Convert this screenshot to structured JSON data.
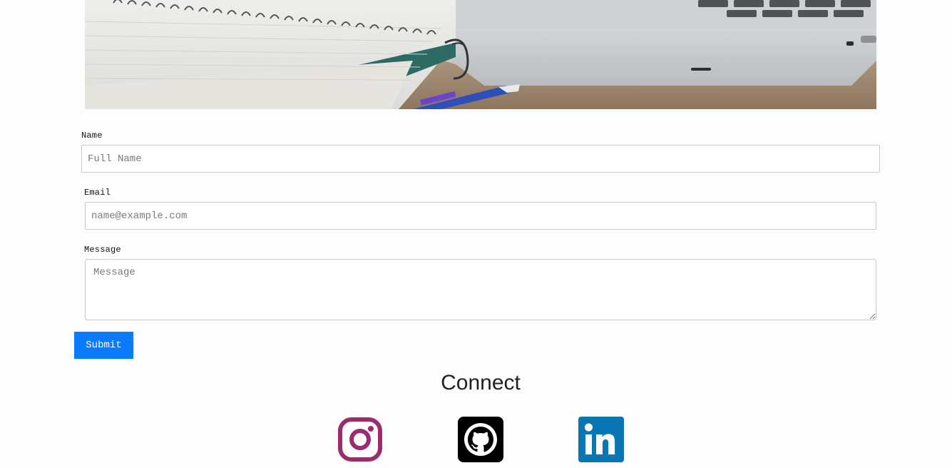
{
  "form": {
    "name": {
      "label": "Name",
      "placeholder": "Full Name",
      "value": ""
    },
    "email": {
      "label": "Email",
      "placeholder": "name@example.com",
      "value": ""
    },
    "message": {
      "label": "Message",
      "placeholder": "Message",
      "value": ""
    },
    "submit_label": "Submit"
  },
  "connect": {
    "title": "Connect",
    "links": [
      {
        "icon": "instagram-icon",
        "color": "#9b2d6e"
      },
      {
        "icon": "github-icon",
        "color": "#000000"
      },
      {
        "icon": "linkedin-icon",
        "color": "#0a76b4"
      }
    ]
  },
  "colors": {
    "accent": "#0a7bff",
    "background": "#fdfdfd",
    "input_border": "#c8c8c8"
  }
}
